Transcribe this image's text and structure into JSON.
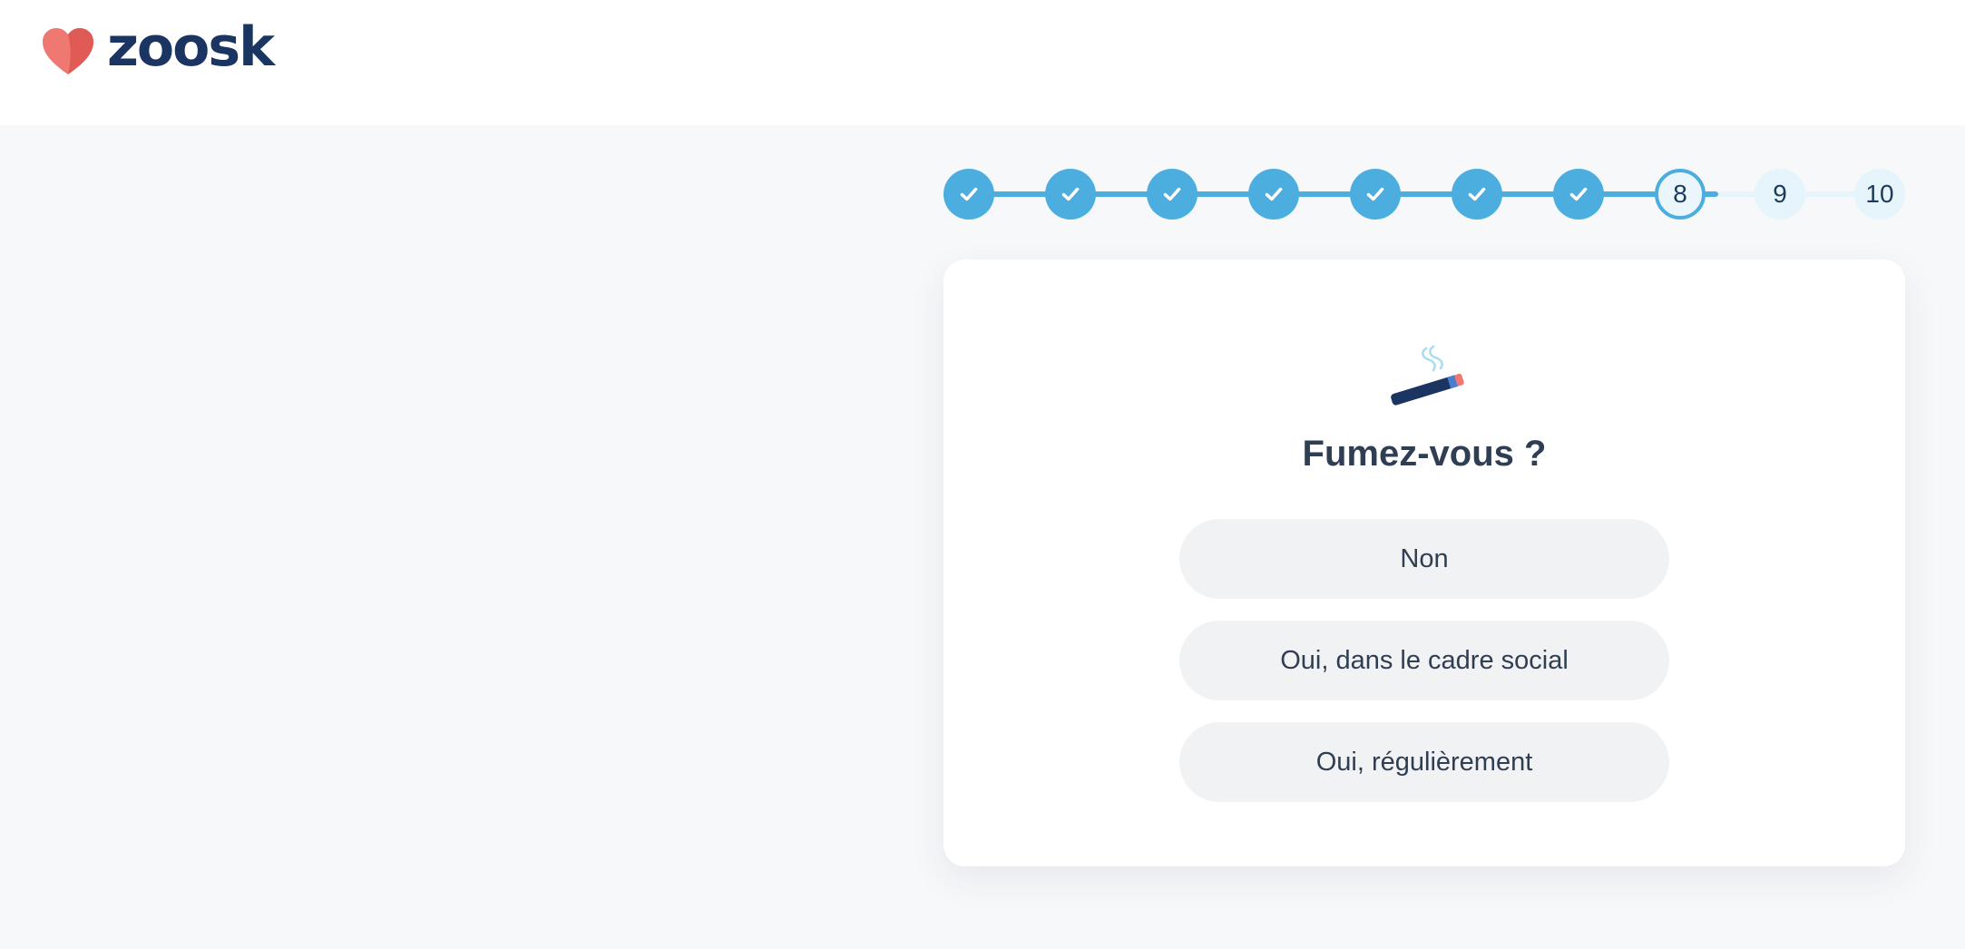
{
  "brand": {
    "name": "zoosk",
    "text_color": "#1b3563",
    "heart_colors": [
      "#f07872",
      "#e05a56"
    ]
  },
  "progress": {
    "current_step": 8,
    "total_steps": 10,
    "steps": [
      {
        "label": "",
        "status": "done",
        "icon": "check-icon"
      },
      {
        "label": "",
        "status": "done",
        "icon": "check-icon"
      },
      {
        "label": "",
        "status": "done",
        "icon": "check-icon"
      },
      {
        "label": "",
        "status": "done",
        "icon": "check-icon"
      },
      {
        "label": "",
        "status": "done",
        "icon": "check-icon"
      },
      {
        "label": "",
        "status": "done",
        "icon": "check-icon"
      },
      {
        "label": "",
        "status": "done",
        "icon": "check-icon"
      },
      {
        "label": "8",
        "status": "current"
      },
      {
        "label": "9",
        "status": "todo"
      },
      {
        "label": "10",
        "status": "todo"
      }
    ],
    "accent_color": "#4caede"
  },
  "question": {
    "icon": "cigarette-icon",
    "title": "Fumez-vous ?",
    "options": [
      {
        "label": "Non"
      },
      {
        "label": "Oui, dans le cadre social"
      },
      {
        "label": "Oui, régulièrement"
      }
    ]
  }
}
